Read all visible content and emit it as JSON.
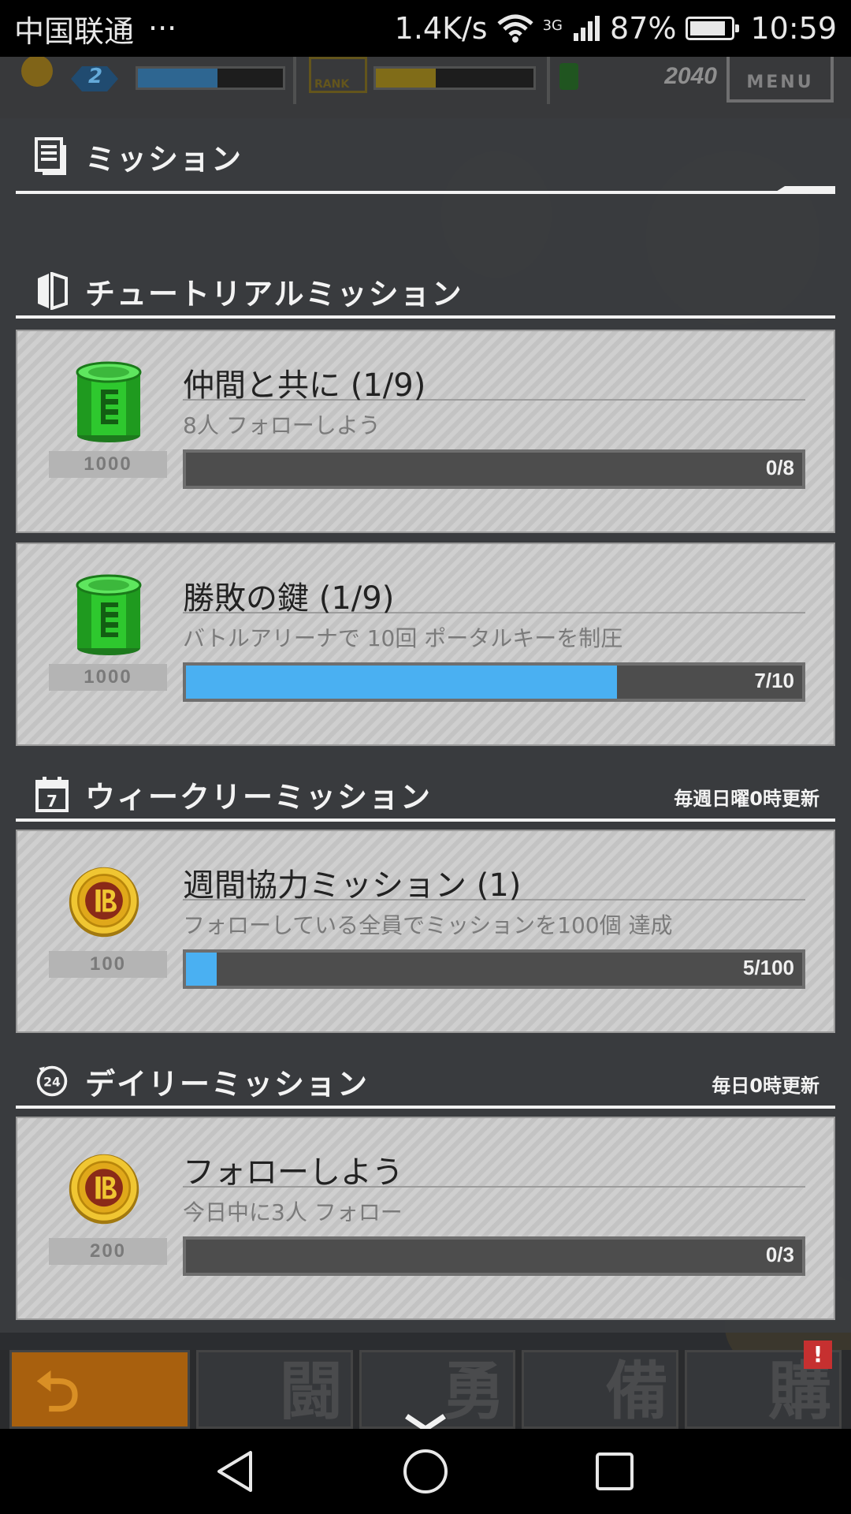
{
  "status_bar": {
    "carrier": "中国联通",
    "more": "···",
    "speed": "1.4K/s",
    "network": "3G",
    "battery": "87%",
    "battery_level": 0.87,
    "time": "10:59"
  },
  "hud": {
    "level": "2",
    "rank_label": "RANK",
    "currency": "2040",
    "menu_label": "MENU"
  },
  "page": {
    "title": "ミッション"
  },
  "sections": [
    {
      "title": "チュートリアルミッション",
      "note": "",
      "missions": [
        {
          "title": "仲間と共に (1/9)",
          "desc": "8人 フォローしよう",
          "reward": "1000",
          "reward_icon": "green-can-icon",
          "progress": "0/8",
          "ratio": 0.0
        },
        {
          "title": "勝敗の鍵 (1/9)",
          "desc": "バトルアリーナで 10回 ポータルキーを制圧",
          "reward": "1000",
          "reward_icon": "green-can-icon",
          "progress": "7/10",
          "ratio": 0.7
        }
      ]
    },
    {
      "title": "ウィークリーミッション",
      "note": "毎週日曜0時更新",
      "missions": [
        {
          "title": "週間協力ミッション (1)",
          "desc": "フォローしている全員でミッションを100個 達成",
          "reward": "100",
          "reward_icon": "gold-coin-icon",
          "progress": "5/100",
          "ratio": 0.05
        }
      ]
    },
    {
      "title": "デイリーミッション",
      "note": "毎日0時更新",
      "missions": [
        {
          "title": "フォローしよう",
          "desc": "今日中に3人 フォロー",
          "reward": "200",
          "reward_icon": "gold-coin-icon",
          "progress": "0/3",
          "ratio": 0.0
        }
      ]
    }
  ],
  "game_nav": {
    "back_glyph": "⮌",
    "items": [
      "闘",
      "勇",
      "備",
      "購"
    ],
    "alert": "!"
  },
  "colors": {
    "progress_fill": "#4ab0f2",
    "card_bg": "#cfcfcf",
    "panel_bg": "#3a3c40"
  }
}
